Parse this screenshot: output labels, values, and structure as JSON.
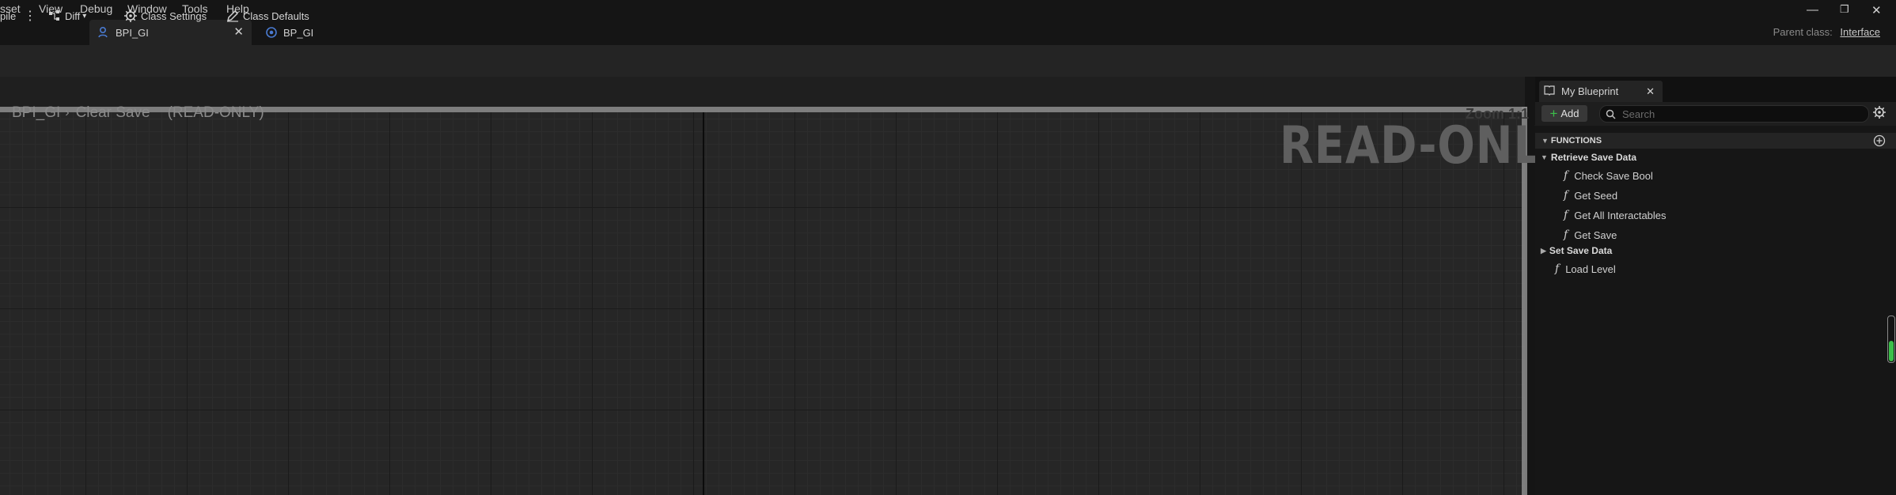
{
  "menu": {
    "items": [
      "sset",
      "View",
      "Debug",
      "Window",
      "Tools",
      "Help"
    ]
  },
  "tabs": [
    {
      "label": "BPI_GI",
      "active": true
    },
    {
      "label": "BP_GI",
      "active": false
    }
  ],
  "window": {
    "parent_class_label": "Parent class:",
    "parent_class_value": "Interface"
  },
  "toolbar": {
    "compile_label": "pile",
    "diff_label": "Diff",
    "class_settings_label": "Class Settings",
    "class_defaults_label": "Class Defaults"
  },
  "graph": {
    "breadcrumb_root": "BPI_GI",
    "breadcrumb_current": "Clear Save",
    "breadcrumb_mode": "(READ-ONLY)",
    "zoom_label": "Zoom 1:1",
    "watermark": "READ-ONLY"
  },
  "my_blueprint": {
    "tab_label": "My Blueprint",
    "add_label": "Add",
    "search_placeholder": "Search",
    "functions_header": "FUNCTIONS",
    "categories": [
      {
        "name": "Retrieve Save Data",
        "expanded": true,
        "functions": [
          "Check Save Bool",
          "Get Seed",
          "Get All Interactables",
          "Get Save"
        ]
      },
      {
        "name": "Set Save Data",
        "expanded": false,
        "functions": []
      }
    ],
    "uncategorized_functions": [
      "Load Level"
    ]
  },
  "colors": {
    "accent_green": "#3cc04a",
    "tab_icon_blue": "#4a7ad0"
  }
}
